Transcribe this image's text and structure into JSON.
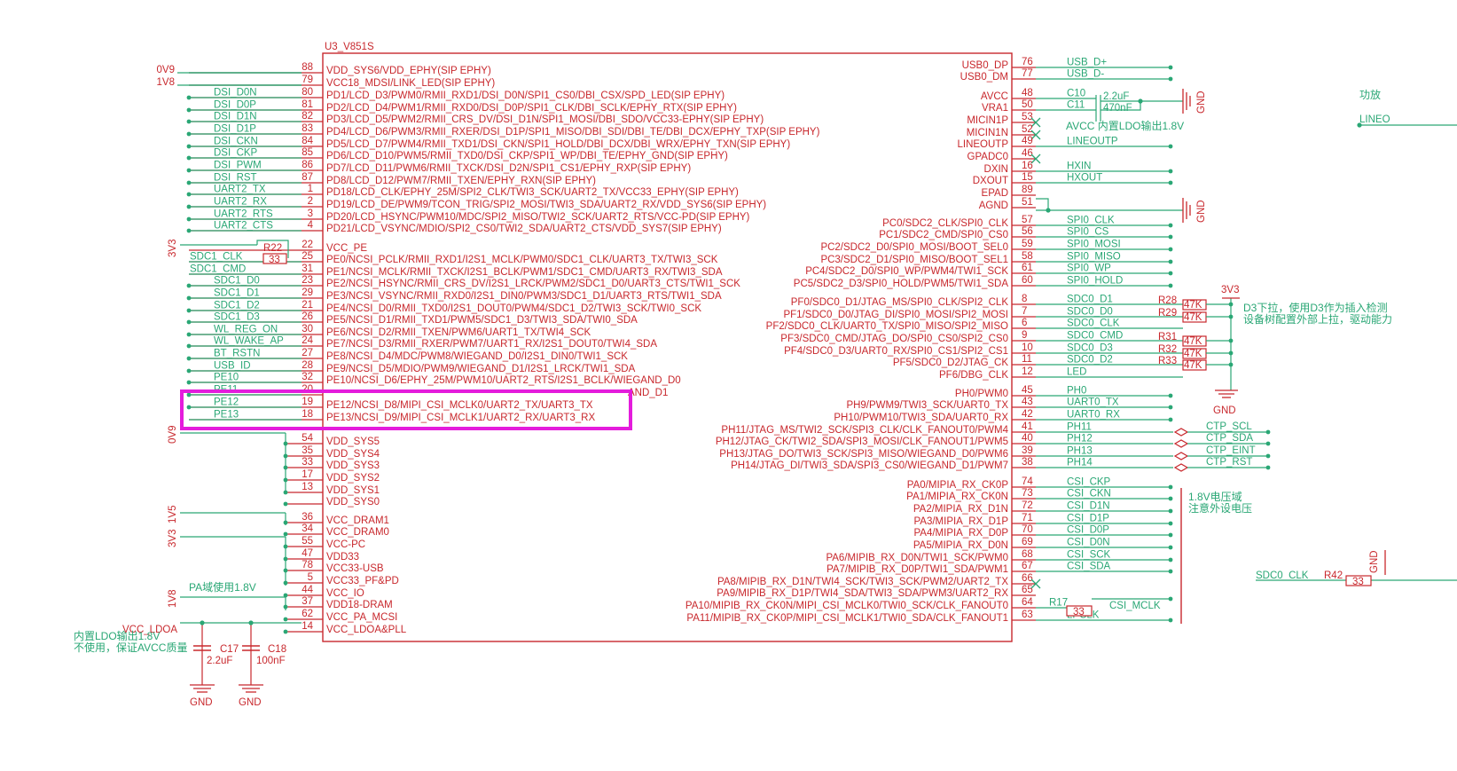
{
  "colors": {
    "wire": "#2aa775",
    "part": "#c8282d",
    "highlight": "#e41cdc",
    "background": "#ffffff"
  },
  "chip": {
    "title": "U3_V851S"
  },
  "left_pins": [
    {
      "num": "88",
      "name": "VDD_SYS6/VDD_EPHY(SIP EPHY)",
      "net": "0V9",
      "net_style": "power"
    },
    {
      "num": "79",
      "name": "VCC18_MDSI/LINK_LED(SIP EPHY)",
      "net": "1V8",
      "net_style": "power"
    },
    {
      "num": "80",
      "name": "PD1/LCD_D3/PWM0/RMII_RXD1/DSI_D0N/SPI1_CS0/DBI_CSX/SPD_LED(SIP EPHY)",
      "net": "DSI_D0N"
    },
    {
      "num": "81",
      "name": "PD2/LCD_D4/PWM1/RMII_RXD0/DSI_D0P/SPI1_CLK/DBI_SCLK/EPHY_RTX(SIP EPHY)",
      "net": "DSI_D0P"
    },
    {
      "num": "82",
      "name": "PD3/LCD_D5/PWM2/RMII_CRS_DV/DSI_D1N/SPI1_MOSI/DBI_SDO/VCC33-EPHY(SIP EPHY)",
      "net": "DSI_D1N"
    },
    {
      "num": "83",
      "name": "PD4/LCD_D6/PWM3/RMII_RXER/DSI_D1P/SPI1_MISO/DBI_SDI/DBI_TE/DBI_DCX/EPHY_TXP(SIP EPHY)",
      "net": "DSI_D1P"
    },
    {
      "num": "84",
      "name": "PD5/LCD_D7/PWM4/RMII_TXD1/DSI_CKN/SPI1_HOLD/DBI_DCX/DBI_WRX/EPHY_TXN(SIP EPHY)",
      "net": "DSI_CKN"
    },
    {
      "num": "85",
      "name": "PD6/LCD_D10/PWM5/RMII_TXD0/DSI_CKP/SPI1_WP/DBI_TE/EPHY_GND(SIP EPHY)",
      "net": "DSI_CKP"
    },
    {
      "num": "86",
      "name": "PD7/LCD_D11/PWM6/RMII_TXCK/DSI_D2N/SPI1_CS1/EPHY_RXP(SIP EPHY)",
      "net": "DSI_PWM"
    },
    {
      "num": "87",
      "name": "PD8/LCD_D12/PWM7/RMII_TXEN/EPHY_RXN(SIP EPHY)",
      "net": "DSI_RST"
    },
    {
      "num": "1",
      "name": "PD18/LCD_CLK/EPHY_25M/SPI2_CLK/TWI3_SCK/UART2_TX/VCC33_EPHY(SIP EPHY)",
      "net": "UART2_TX"
    },
    {
      "num": "2",
      "name": "PD19/LCD_DE/PWM9/TCON_TRIG/SPI2_MOSI/TWI3_SDA/UART2_RX/VDD_SYS6(SIP EPHY)",
      "net": "UART2_RX"
    },
    {
      "num": "3",
      "name": "PD20/LCD_HSYNC/PWM10/MDC/SPI2_MISO/TWI2_SCK/UART2_RTS/VCC-PD(SIP EPHY)",
      "net": "UART2_RTS"
    },
    {
      "num": "4",
      "name": "PD21/LCD_VSYNC/MDIO/SPI2_CS0/TWI2_SDA/UART2_CTS/VDD_SYS7(SIP EPHY)",
      "net": "UART2_CTS"
    },
    {
      "num": "22",
      "name": "VCC_PE",
      "net": ""
    },
    {
      "num": "25",
      "name": "PE0/NCSI_PCLK/RMII_RXD1/I2S1_MCLK/PWM0/SDC1_CLK/UART3_TX/TWI3_SCK",
      "net": "SDC1_CLK"
    },
    {
      "num": "31",
      "name": "PE1/NCSI_MCLK/RMII_TXCK/I2S1_BCLK/PWM1/SDC1_CMD/UART3_RX/TWI3_SDA",
      "net": "SDC1_CMD"
    },
    {
      "num": "23",
      "name": "PE2/NCSI_HSYNC/RMII_CRS_DV/I2S1_LRCK/PWM2/SDC1_D0/UART3_CTS/TWI1_SCK",
      "net": "SDC1_D0"
    },
    {
      "num": "29",
      "name": "PE3/NCSI_VSYNC/RMII_RXD0/I2S1_DIN0/PWM3/SDC1_D1/UART3_RTS/TWI1_SDA",
      "net": "SDC1_D1"
    },
    {
      "num": "21",
      "name": "PE4/NCSI_D0/RMII_TXD0/I2S1_DOUT0/PWM4/SDC1_D2/TWI3_SCK/TWI0_SCK",
      "net": "SDC1_D2"
    },
    {
      "num": "26",
      "name": "PE5/NCSI_D1/RMII_TXD1/PWM5/SDC1_D3/TWI3_SDA/TWI0_SDA",
      "net": "SDC1_D3"
    },
    {
      "num": "30",
      "name": "PE6/NCSI_D2/RMII_TXEN/PWM6/UART1_TX/TWI4_SCK",
      "net": "WL_REG_ON"
    },
    {
      "num": "24",
      "name": "PE7/NCSI_D3/RMII_RXER/PWM7/UART1_RX/I2S1_DOUT0/TWI4_SDA",
      "net": "WL_WAKE_AP"
    },
    {
      "num": "27",
      "name": "PE8/NCSI_D4/MDC/PWM8/WIEGAND_D0/I2S1_DIN0/TWI1_SCK",
      "net": "BT_RSTN"
    },
    {
      "num": "28",
      "name": "PE9/NCSI_D5/MDIO/PWM9/WIEGAND_D1/I2S1_LRCK/TWI1_SDA",
      "net": "USB_ID"
    },
    {
      "num": "32",
      "name": "PE10/NCSI_D6/EPHY_25M/PWM10/UART2_RTS/I2S1_BCLK/WIEGAND_D0",
      "net": "PE10"
    },
    {
      "num": "20",
      "name": "",
      "net": "PE11"
    },
    {
      "num": "19",
      "name": "PE12/NCSI_D8/MIPI_CSI_MCLK0/UART2_TX/UART3_TX",
      "net": "PE12"
    },
    {
      "num": "18",
      "name": "PE13/NCSI_D9/MIPI_CSI_MCLK1/UART2_RX/UART3_RX",
      "net": "PE13"
    },
    {
      "num": "54",
      "name": "VDD_SYS5",
      "net": ""
    },
    {
      "num": "35",
      "name": "VDD_SYS4",
      "net": ""
    },
    {
      "num": "33",
      "name": "VDD_SYS3",
      "net": ""
    },
    {
      "num": "17",
      "name": "VDD_SYS2",
      "net": ""
    },
    {
      "num": "13",
      "name": "VDD_SYS1",
      "net": ""
    },
    {
      "num": "",
      "name": "VDD_SYS0",
      "net": ""
    },
    {
      "num": "36",
      "name": "VCC_DRAM1",
      "net": ""
    },
    {
      "num": "34",
      "name": "VCC_DRAM0",
      "net": ""
    },
    {
      "num": "55",
      "name": "VCC-PC",
      "net": ""
    },
    {
      "num": "47",
      "name": "VDD33",
      "net": ""
    },
    {
      "num": "78",
      "name": "VCC33-USB",
      "net": ""
    },
    {
      "num": "5",
      "name": "VCC33_PF&PD",
      "net": ""
    },
    {
      "num": "44",
      "name": "VCC_IO",
      "net": ""
    },
    {
      "num": "37",
      "name": "VDD18-DRAM",
      "net": ""
    },
    {
      "num": "62",
      "name": "VCC_PA_MCSI",
      "net": ""
    },
    {
      "num": "14",
      "name": "VCC_LDOA&PLL",
      "net": "VCC_LDOA"
    }
  ],
  "partial_texts": {
    "pe11_covered": "AND_D1"
  },
  "right_pins": [
    {
      "num": "76",
      "name": "USB0_DP",
      "net": "USB_D+"
    },
    {
      "num": "77",
      "name": "USB0_DM",
      "net": "USB_D-"
    },
    {
      "num": "48",
      "name": "AVCC",
      "net": "C10"
    },
    {
      "num": "50",
      "name": "VRA1",
      "net": "C11"
    },
    {
      "num": "53",
      "name": "MICIN1P",
      "net": ""
    },
    {
      "num": "52",
      "name": "MICIN1N",
      "net": ""
    },
    {
      "num": "49",
      "name": "LINEOUTP",
      "net": "LINEOUTP"
    },
    {
      "num": "46",
      "name": "GPADC0",
      "net": ""
    },
    {
      "num": "16",
      "name": "DXIN",
      "net": "HXIN"
    },
    {
      "num": "15",
      "name": "DXOUT",
      "net": "HXOUT"
    },
    {
      "num": "89",
      "name": "EPAD",
      "net": ""
    },
    {
      "num": "51",
      "name": "AGND",
      "net": ""
    },
    {
      "num": "57",
      "name": "PC0/SDC2_CLK/SPI0_CLK",
      "net": "SPI0_CLK"
    },
    {
      "num": "56",
      "name": "PC1/SDC2_CMD/SPI0_CS0",
      "net": "SPI0_CS"
    },
    {
      "num": "59",
      "name": "PC2/SDC2_D0/SPI0_MOSI/BOOT_SEL0",
      "net": "SPI0_MOSI"
    },
    {
      "num": "58",
      "name": "PC3/SDC2_D1/SPI0_MISO/BOOT_SEL1",
      "net": "SPI0_MISO"
    },
    {
      "num": "61",
      "name": "PC4/SDC2_D0/SPI0_WP/PWM4/TWI1_SCK",
      "net": "SPI0_WP"
    },
    {
      "num": "60",
      "name": "PC5/SDC2_D3/SPI0_HOLD/PWM5/TWI1_SDA",
      "net": "SPI0_HOLD"
    },
    {
      "num": "8",
      "name": "PF0/SDC0_D1/JTAG_MS/SPI0_CLK/SPI2_CLK",
      "net": "SDC0_D1"
    },
    {
      "num": "7",
      "name": "PF1/SDC0_D0/JTAG_DI/SPI0_MOSI/SPI2_MOSI",
      "net": "SDC0_D0"
    },
    {
      "num": "6",
      "name": "PF2/SDC0_CLK/UART0_TX/SPI0_MISO/SPI2_MISO",
      "net": "SDC0_CLK"
    },
    {
      "num": "9",
      "name": "PF3/SDC0_CMD/JTAG_DO/SPI0_CS0/SPI2_CS0",
      "net": "SDC0_CMD"
    },
    {
      "num": "10",
      "name": "PF4/SDC0_D3/UART0_RX/SPI0_CS1/SPI2_CS1",
      "net": "SDC0_D3"
    },
    {
      "num": "11",
      "name": "PF5/SDC0_D2/JTAG_CK",
      "net": "SDC0_D2"
    },
    {
      "num": "12",
      "name": "PF6/DBG_CLK",
      "net": "LED"
    },
    {
      "num": "45",
      "name": "PH0/PWM0",
      "net": "PH0"
    },
    {
      "num": "43",
      "name": "PH9/PWM9/TWI3_SCK/UART0_TX",
      "net": "UART0_TX"
    },
    {
      "num": "42",
      "name": "PH10/PWM10/TWI3_SDA/UART0_RX",
      "net": "UART0_RX"
    },
    {
      "num": "41",
      "name": "PH11/JTAG_MS/TWI2_SCK/SPI3_CLK/CLK_FANOUT0/PWM4",
      "net": "PH11"
    },
    {
      "num": "40",
      "name": "PH12/JTAG_CK/TWI2_SDA/SPI3_MOSI/CLK_FANOUT1/PWM5",
      "net": "PH12"
    },
    {
      "num": "39",
      "name": "PH13/JTAG_DO/TWI3_SCK/SPI3_MISO/WIEGAND_D0/PWM6",
      "net": "PH13"
    },
    {
      "num": "38",
      "name": "PH14/JTAG_DI/TWI3_SDA/SPI3_CS0/WIEGAND_D1/PWM7",
      "net": "PH14"
    },
    {
      "num": "74",
      "name": "PA0/MIPIA_RX_CK0P",
      "net": "CSI_CKP"
    },
    {
      "num": "73",
      "name": "PA1/MIPIA_RX_CK0N",
      "net": "CSI_CKN"
    },
    {
      "num": "72",
      "name": "PA2/MIPIA_RX_D1N",
      "net": "CSI_D1N"
    },
    {
      "num": "71",
      "name": "PA3/MIPIA_RX_D1P",
      "net": "CSI_D1P"
    },
    {
      "num": "70",
      "name": "PA4/MIPIA_RX_D0P",
      "net": "CSI_D0P"
    },
    {
      "num": "69",
      "name": "PA5/MIPIA_RX_D0N",
      "net": "CSI_D0N"
    },
    {
      "num": "68",
      "name": "PA6/MIPIB_RX_D0N/TWI1_SCK/PWM0",
      "net": "CSI_SCK"
    },
    {
      "num": "67",
      "name": "PA7/MIPIB_RX_D0P/TWI1_SDA/PWM1",
      "net": "CSI_SDA"
    },
    {
      "num": "66",
      "name": "PA8/MIPIB_RX_D1N/TWI4_SCK/TWI3_SCK/PWM2/UART2_TX",
      "net": "CSI_RSTN"
    },
    {
      "num": "65",
      "name": "PA9/MIPIB_RX_D1P/TWI4_SDA/TWI3_SDA/PWM3/UART2_RX",
      "net": ""
    },
    {
      "num": "64",
      "name": "PA10/MIPIB_RX_CK0N/MIPI_CSI_MCLK0/TWI0_SCK/CLK_FANOUT0",
      "net": "R17"
    },
    {
      "num": "63",
      "name": "PA11/MIPIB_RX_CK0P/MIPI_CSI_MCLK1/TWI0_SDA/CLK_FANOUT1",
      "net": "LPCLK"
    }
  ],
  "power_labels": {
    "v09_bottom": "0V9",
    "v1v5": "1V5",
    "v3v3_left": "3V3",
    "v1v8_bottom": "1V8",
    "v3v3_right": "3V3",
    "v3v3_pe": "3V3"
  },
  "passives": {
    "r22": {
      "ref": "R22",
      "value": "33"
    },
    "c10": {
      "value": "2.2uF"
    },
    "c11": {
      "value": "470nF"
    },
    "r28": {
      "ref": "R28",
      "value": "47K"
    },
    "r29": {
      "ref": "R29",
      "value": "47K"
    },
    "r31": {
      "ref": "R31",
      "value": "47K"
    },
    "r32": {
      "ref": "R32",
      "value": "47K"
    },
    "r33": {
      "ref": "R33",
      "value": "47K"
    },
    "r17": {
      "value": "33"
    },
    "csi_mclk": "CSI_MCLK",
    "c17": {
      "ref": "C17",
      "value": "2.2uF"
    },
    "c18": {
      "ref": "C18",
      "value": "100nF"
    },
    "r42": {
      "ref": "R42",
      "value": "33"
    },
    "sdc0_clk_right": "SDC0_CLK"
  },
  "ctp_nets": [
    "CTP_SCL",
    "CTP_SDA",
    "CTP_EINT",
    "CTP_RST"
  ],
  "gnd_label": "GND",
  "notes": {
    "avcc_ldo": "AVCC 内置LDO输出1.8V",
    "pa_domain": "PA域使用1.8V",
    "v18_domain_1": "1.8V电压域",
    "v18_domain_2": "注意外设电压",
    "d3_pullup_1": "D3下拉，使用D3作为插入检测",
    "d3_pullup_2": "设备树配置外部上拉，驱动能力",
    "ldo_1": "内置LDO输出1.8V",
    "ldo_2": "不使用，保证AVCC质量",
    "amp": "功放",
    "lineo": "LINEO"
  }
}
